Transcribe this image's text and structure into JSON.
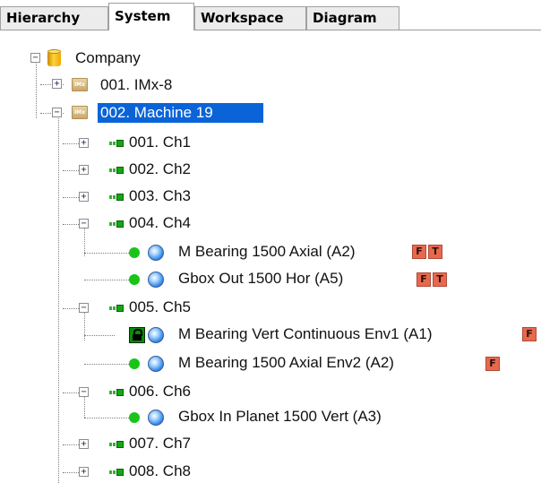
{
  "tabs": [
    {
      "label": "Hierarchy"
    },
    {
      "label": "System"
    },
    {
      "label": "Workspace"
    },
    {
      "label": "Diagram"
    }
  ],
  "active_tab": "System",
  "colors": {
    "selection": "#0a64d8",
    "status_ok": "#19c419",
    "badge": "#e8684e"
  },
  "tree": {
    "root": {
      "label": "Company",
      "icon": "database-icon",
      "expanded": true
    },
    "nodes": [
      {
        "label": "001. IMx-8",
        "icon": "device-folder-icon",
        "expanded": false
      },
      {
        "label": "002. Machine 19",
        "icon": "device-folder-icon",
        "expanded": true,
        "selected": true
      }
    ],
    "channels": [
      {
        "label": "001. Ch1",
        "expanded": false
      },
      {
        "label": "002. Ch2",
        "expanded": false
      },
      {
        "label": "003. Ch3",
        "expanded": false
      },
      {
        "label": "004. Ch4",
        "expanded": true
      },
      {
        "label": "005. Ch5",
        "expanded": true
      },
      {
        "label": "006. Ch6",
        "expanded": true
      },
      {
        "label": "007. Ch7",
        "expanded": false
      },
      {
        "label": "008. Ch8",
        "expanded": false
      }
    ],
    "measurements": [
      {
        "label": "M Bearing 1500 Axial (A2)",
        "status": "green-dot",
        "badges": [
          "F",
          "T"
        ]
      },
      {
        "label": "Gbox Out 1500 Hor (A5)",
        "status": "green-dot",
        "badges": [
          "F",
          "T"
        ]
      },
      {
        "label": "M Bearing Vert Continuous Env1 (A1)",
        "status": "lock",
        "badges": [
          "F"
        ]
      },
      {
        "label": "M Bearing 1500 Axial Env2 (A2)",
        "status": "green-dot",
        "badges": [
          "F"
        ]
      },
      {
        "label": "Gbox In Planet 1500 Vert (A3)",
        "status": "green-dot",
        "badges": []
      }
    ],
    "expander": {
      "collapsed": "+",
      "expanded": "−"
    }
  }
}
